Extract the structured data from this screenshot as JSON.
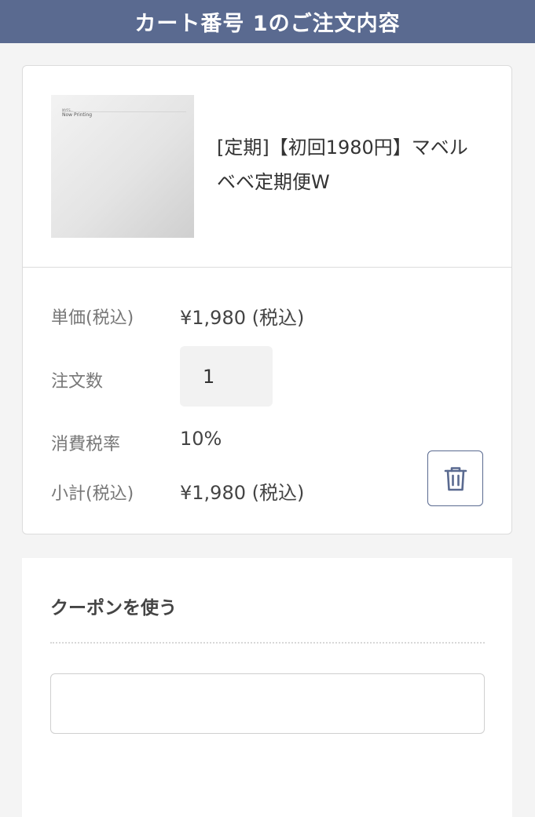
{
  "header": {
    "title": "カート番号 1のご注文内容"
  },
  "product": {
    "image_brand": "MYFS...",
    "image_text": "Now Printing",
    "name": "[定期]【初回1980円】マベルベベ定期便W"
  },
  "details": {
    "unit_price_label": "単価(税込)",
    "unit_price_value": "¥1,980 (税込)",
    "quantity_label": "注文数",
    "quantity_value": "1",
    "tax_rate_label": "消費税率",
    "tax_rate_value": "10%",
    "subtotal_label": "小計(税込)",
    "subtotal_value": "¥1,980 (税込)"
  },
  "delete_button": {
    "icon": "trash-icon",
    "color": "#5a6a90"
  },
  "coupon": {
    "title": "クーポンを使う",
    "input_value": "",
    "input_placeholder": ""
  },
  "colors": {
    "header_bg": "#5a6a90",
    "page_bg": "#f4f4f4"
  }
}
